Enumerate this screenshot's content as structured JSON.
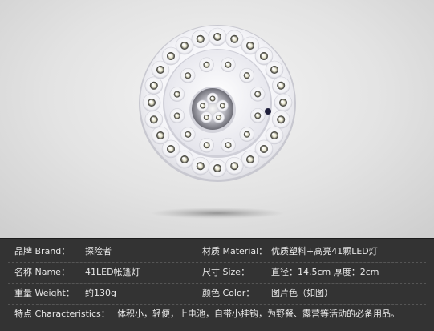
{
  "product": {
    "image_label": "41LED camping lantern product photo"
  },
  "specs": {
    "brand": {
      "label": "品牌 Brand：",
      "value": "探险者"
    },
    "material": {
      "label": "材质 Material：",
      "value": "优质塑料+高亮41颗LED灯"
    },
    "name": {
      "label": "名称 Name：",
      "value": "41LED帐篷灯"
    },
    "size": {
      "label": "尺寸 Size：",
      "value": "直径：14.5cm  厚度：2cm"
    },
    "weight": {
      "label": "重量  Weight：",
      "value": "约130g"
    },
    "color": {
      "label": "颜色 Color：",
      "value": "图片色（如图）"
    },
    "features": {
      "label": "特点 Characteristics：",
      "value": "体积小，轻便，上电池，自带小挂钩，为野餐、露营等活动的必备用品。"
    }
  }
}
